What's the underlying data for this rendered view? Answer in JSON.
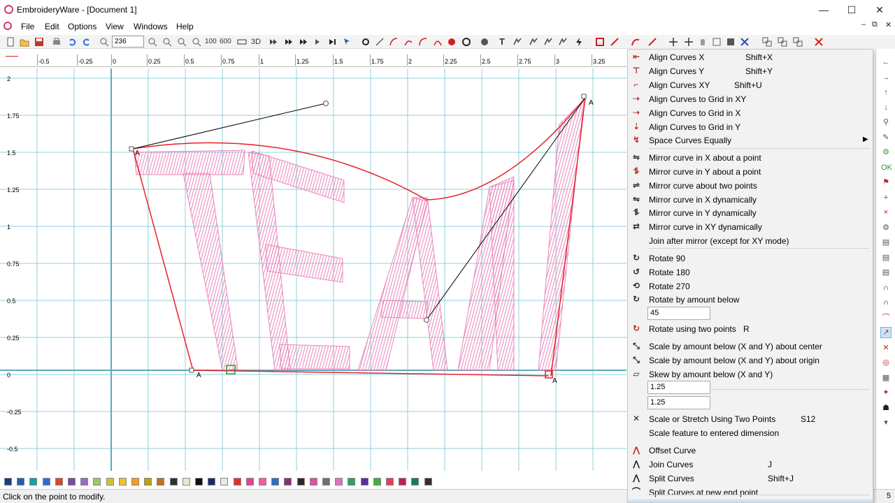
{
  "window": {
    "title": "EmbroideryWare - [Document 1]",
    "minimize": "—",
    "maximize": "☐",
    "close": "✕"
  },
  "menubar": {
    "items": [
      "File",
      "Edit",
      "Options",
      "View",
      "Windows",
      "Help"
    ],
    "mdi_controls": [
      "–",
      "⧉",
      "✕"
    ]
  },
  "toolbar": {
    "zoom_value": "236",
    "label_100": "100",
    "label_600": "600",
    "label_3d": "3D"
  },
  "ruler": {
    "x_ticks": [
      "-0.5",
      "-0.25",
      "0",
      "0.25",
      "0.5",
      "0.75",
      "1",
      "1.25",
      "1.5",
      "1.75",
      "2",
      "2.25",
      "2.5",
      "2.75",
      "3",
      "3.25"
    ],
    "y_ticks": [
      "2",
      "1.75",
      "1.5",
      "1.25",
      "1",
      "0.75",
      "0.5",
      "0.25",
      "0",
      "-0.25",
      "-0.5"
    ]
  },
  "design": {
    "text": "TEAM",
    "stitch_color": "#e87bb5",
    "curve_color": "#e8202a",
    "grid_color": "#8fd0da",
    "control_point_label": "A"
  },
  "menu": {
    "items": [
      {
        "label": "Align Curves X",
        "shortcut": "Shift+X",
        "icon": "align-x-icon"
      },
      {
        "label": "Align Curves Y",
        "shortcut": "Shift+Y",
        "icon": "align-y-icon"
      },
      {
        "label": "Align Curves XY",
        "shortcut": "Shift+U",
        "icon": "align-xy-icon"
      },
      {
        "label": "Align Curves to Grid in XY",
        "shortcut": "",
        "icon": "align-grid-xy-icon"
      },
      {
        "label": "Align Curves to Grid in X",
        "shortcut": "",
        "icon": "align-grid-x-icon"
      },
      {
        "label": "Align Curves to Grid in Y",
        "shortcut": "",
        "icon": "align-grid-y-icon"
      },
      {
        "label": "Space Curves Equally",
        "shortcut": "",
        "icon": "space-equally-icon"
      },
      {
        "label": "Mirror curve in X about a point",
        "shortcut": "",
        "icon": "mirror-x-icon"
      },
      {
        "label": "Mirror curve in Y about a point",
        "shortcut": "",
        "icon": "mirror-y-icon"
      },
      {
        "label": "Mirror curve about two points",
        "shortcut": "",
        "icon": "mirror-two-points-icon"
      },
      {
        "label": "Mirror curve in X dynamically",
        "shortcut": "",
        "icon": "mirror-x-dynamic-icon"
      },
      {
        "label": "Mirror curve in Y dynamically",
        "shortcut": "",
        "icon": "mirror-y-dynamic-icon"
      },
      {
        "label": "Mirror curve in XY dynamically",
        "shortcut": "",
        "icon": "mirror-xy-dynamic-icon"
      },
      {
        "label": "Join after mirror (except for XY mode)",
        "shortcut": "",
        "icon": ""
      },
      {
        "label": "Rotate 90",
        "shortcut": "",
        "icon": "rotate-90-icon"
      },
      {
        "label": "Rotate 180",
        "shortcut": "",
        "icon": "rotate-180-icon"
      },
      {
        "label": "Rotate 270",
        "shortcut": "",
        "icon": "rotate-270-icon"
      },
      {
        "label": "Rotate by amount below",
        "shortcut": "",
        "icon": "rotate-amount-icon"
      },
      {
        "label": "Rotate using two points",
        "shortcut": "R",
        "icon": "rotate-two-points-icon"
      },
      {
        "label": "Scale by amount below (X and Y) about center",
        "shortcut": "",
        "icon": "scale-center-icon"
      },
      {
        "label": "Scale by amount below (X and Y) about origin",
        "shortcut": "",
        "icon": "scale-origin-icon"
      },
      {
        "label": "Skew by amount below (X and Y)",
        "shortcut": "",
        "icon": "skew-icon"
      },
      {
        "label": "Scale or Stretch Using Two Points",
        "shortcut": "S12",
        "icon": "stretch-two-points-icon"
      },
      {
        "label": "Scale feature to entered dimension",
        "shortcut": "",
        "icon": ""
      },
      {
        "label": "Offset Curve",
        "shortcut": "",
        "icon": "offset-curve-icon"
      },
      {
        "label": "Join Curves",
        "shortcut": "J",
        "icon": "join-curves-icon"
      },
      {
        "label": "Split Curves",
        "shortcut": "Shift+J",
        "icon": "split-curves-icon"
      },
      {
        "label": "Split Curves at new end point",
        "shortcut": "",
        "icon": "split-end-point-icon"
      }
    ],
    "rotate_amount": "45",
    "skew_x": "1.25",
    "skew_y": "1.25"
  },
  "status": {
    "message": "Click on the point to modify.",
    "right_value": "5"
  },
  "palette": {
    "colors": [
      "#1a3a8a",
      "#1e5fb4",
      "#17a0a0",
      "#2a6fd6",
      "#d84a2a",
      "#7a4aa8",
      "#9a6ac8",
      "#9ac86a",
      "#c8c830",
      "#f0c030",
      "#f0a020",
      "#c0a010",
      "#c07020",
      "#303030",
      "#e8e8c8",
      "#101010",
      "#1a2a6a",
      "#e8e8e8",
      "#e03030",
      "#e84090",
      "#f060a0",
      "#3070c0",
      "#8a3070",
      "#2a2a2a",
      "#e050a0",
      "#707070",
      "#e070c0",
      "#30a060",
      "#5030a0",
      "#40b040",
      "#e04060",
      "#c02050",
      "#108060",
      "#303030"
    ]
  }
}
